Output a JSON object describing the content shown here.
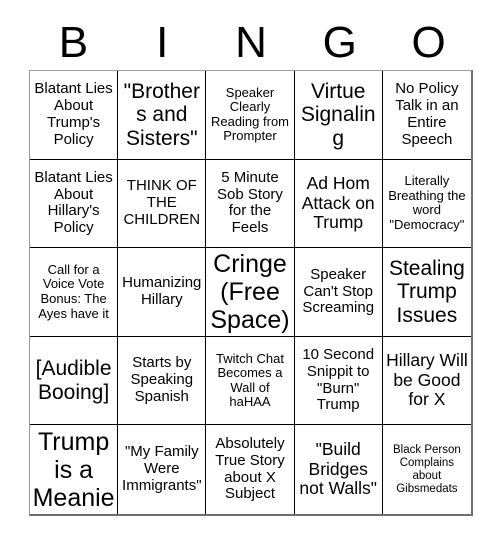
{
  "card": {
    "title": "BINGO",
    "header_letters": [
      "B",
      "I",
      "N",
      "G",
      "O"
    ],
    "columns": 5,
    "rows": 5,
    "border_color": "#000000",
    "background_color": "#ffffff",
    "text_color": "#000000",
    "free_space_index": 12,
    "cells": [
      {
        "text": "Blatant Lies About Trump's Policy",
        "size": "m"
      },
      {
        "text": "\"Brothers and Sisters\"",
        "size": "xl"
      },
      {
        "text": "Speaker Clearly Reading from Prompter",
        "size": "s"
      },
      {
        "text": "Virtue Signaling",
        "size": "xl"
      },
      {
        "text": "No Policy Talk in an Entire Speech",
        "size": "m"
      },
      {
        "text": "Blatant Lies About Hillary's Policy",
        "size": "m"
      },
      {
        "text": "THINK OF THE CHILDREN",
        "size": "m"
      },
      {
        "text": "5 Minute Sob Story for the Feels",
        "size": "m"
      },
      {
        "text": "Ad Hom Attack on Trump",
        "size": "l"
      },
      {
        "text": "Literally Breathing the word \"Democracy\"",
        "size": "s"
      },
      {
        "text": "Call for a Voice Vote Bonus: The Ayes have it",
        "size": "s"
      },
      {
        "text": "Humanizing Hillary",
        "size": "m"
      },
      {
        "text": "Cringe (Free Space)",
        "size": "xxl"
      },
      {
        "text": "Speaker Can't Stop Screaming",
        "size": "m"
      },
      {
        "text": "Stealing Trump Issues",
        "size": "xl"
      },
      {
        "text": "[Audible Booing]",
        "size": "xl"
      },
      {
        "text": "Starts by Speaking Spanish",
        "size": "m"
      },
      {
        "text": "Twitch Chat Becomes a Wall of haHAA",
        "size": "s"
      },
      {
        "text": "10 Second Snippit to \"Burn\" Trump",
        "size": "m"
      },
      {
        "text": "Hillary Will be Good for X",
        "size": "l"
      },
      {
        "text": "Trump is a Meanie",
        "size": "xxl"
      },
      {
        "text": "\"My Family Were Immigrants\"",
        "size": "m"
      },
      {
        "text": "Absolutely True Story about X Subject",
        "size": "m"
      },
      {
        "text": "\"Build Bridges not Walls\"",
        "size": "l"
      },
      {
        "text": "Black Person Complains about Gibsmedats",
        "size": "xs"
      }
    ]
  }
}
